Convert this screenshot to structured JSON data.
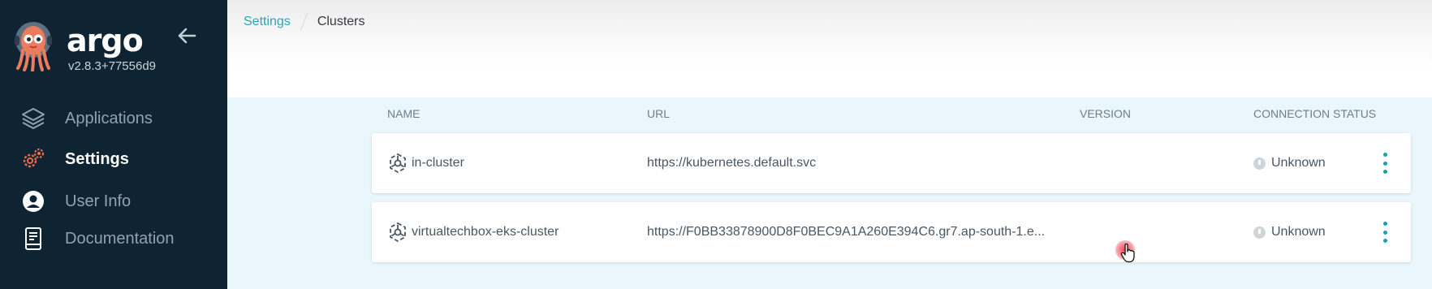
{
  "app": {
    "name": "argo",
    "version": "v2.8.3+77556d9"
  },
  "sidebar": {
    "items": [
      {
        "label": "Applications",
        "icon": "layers-icon",
        "active": false
      },
      {
        "label": "Settings",
        "icon": "gears-icon",
        "active": true
      },
      {
        "label": "User Info",
        "icon": "user-circle-icon",
        "active": false
      },
      {
        "label": "Documentation",
        "icon": "book-icon",
        "active": false
      }
    ]
  },
  "breadcrumb": {
    "parent": "Settings",
    "current": "Clusters"
  },
  "table": {
    "columns": {
      "name": "NAME",
      "url": "URL",
      "version": "VERSION",
      "status": "CONNECTION STATUS"
    },
    "rows": [
      {
        "name": "in-cluster",
        "url": "https://kubernetes.default.svc",
        "version": "",
        "status": "Unknown"
      },
      {
        "name": "virtualtechbox-eks-cluster",
        "url": "https://F0BB33878900D8F0BEC9A1A260E394C6.gr7.ap-south-1.e...",
        "version": "",
        "status": "Unknown"
      }
    ]
  },
  "colors": {
    "sidebar_bg": "#0e2433",
    "accent": "#2aa4b6",
    "active_icon": "#ef6a4c",
    "content_bg": "#e9f6fb"
  }
}
